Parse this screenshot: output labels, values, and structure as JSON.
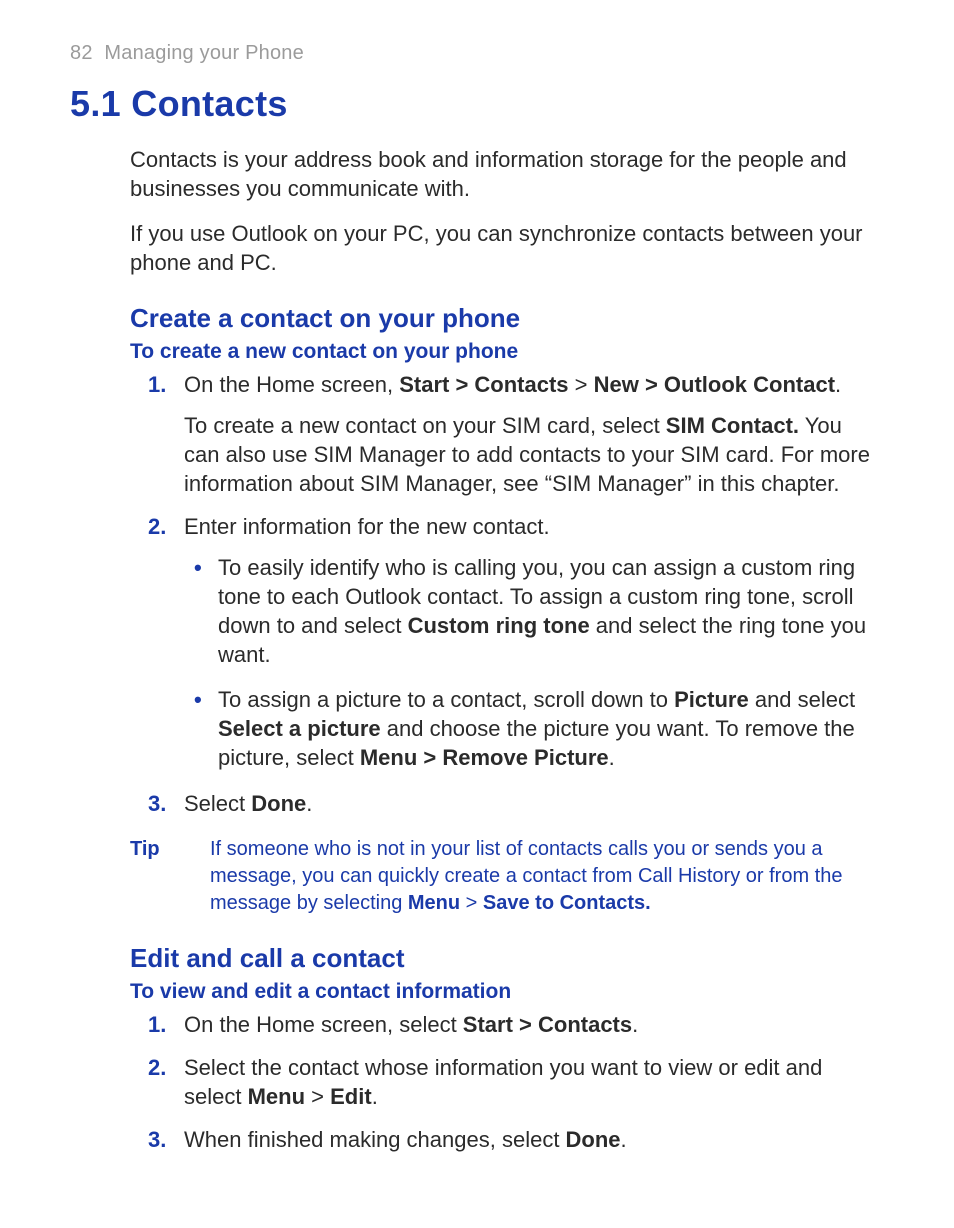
{
  "header": {
    "page_number": "82",
    "chapter_title": "Managing your Phone"
  },
  "section": {
    "number": "5.1",
    "title": "Contacts"
  },
  "intro": {
    "p1": "Contacts is your address book and information storage for the people and businesses you communicate with.",
    "p2": "If you use Outlook on your PC, you can synchronize contacts between your phone and PC."
  },
  "create_section": {
    "heading": "Create a contact on your phone",
    "proc_heading": "To create a new contact on your phone",
    "steps": [
      {
        "marker": "1.",
        "pre": "On the Home screen, ",
        "bold1": "Start > Contacts",
        "mid": " > ",
        "bold2": "New > Outlook Contact",
        "post": ".",
        "followup_pre": "To create a new contact on your SIM card, select ",
        "followup_bold": "SIM Contact.",
        "followup_post": " You can also use SIM Manager to add contacts to your SIM card. For more information about SIM Manager, see “SIM Manager” in this chapter."
      },
      {
        "marker": "2.",
        "text": "Enter information for the new contact.",
        "bullets": [
          {
            "pre": "To easily identify who is calling you, you can assign a custom ring tone to each Outlook contact. To assign a custom ring tone, scroll down to and select ",
            "bold1": "Custom ring tone",
            "post": " and select the ring tone you want."
          },
          {
            "pre": "To assign a picture to a contact, scroll down to ",
            "bold1": "Picture",
            "mid1": " and select ",
            "bold2": "Select a picture",
            "mid2": " and choose the picture you want. To remove the picture, select ",
            "bold3": "Menu > Remove Picture",
            "post": "."
          }
        ]
      },
      {
        "marker": "3.",
        "pre": "Select ",
        "bold1": "Done",
        "post": "."
      }
    ],
    "tip": {
      "label": "Tip",
      "pre": "If someone who is not in your list of contacts calls you or sends you a message, you can quickly create a contact from Call History or from the message by selecting ",
      "bold1": "Menu",
      "mid": " > ",
      "bold2": "Save to Contacts."
    }
  },
  "edit_section": {
    "heading": "Edit and call a contact",
    "proc_heading": "To view and edit a contact information",
    "steps": [
      {
        "marker": "1.",
        "pre": "On the Home screen, select ",
        "bold1": "Start > Contacts",
        "post": "."
      },
      {
        "marker": "2.",
        "pre": "Select the contact whose information you want to view or edit and select ",
        "bold1": "Menu",
        "mid": " > ",
        "bold2": "Edit",
        "post": "."
      },
      {
        "marker": "3.",
        "pre": "When finished making changes, select ",
        "bold1": "Done",
        "post": "."
      }
    ]
  }
}
